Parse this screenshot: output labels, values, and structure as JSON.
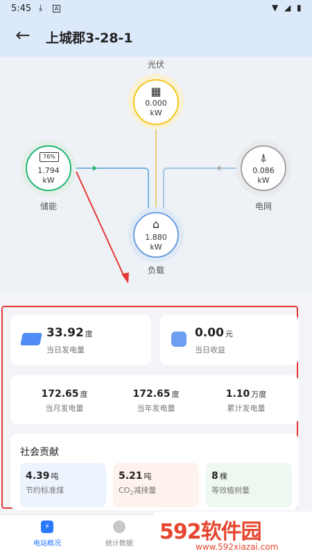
{
  "status": {
    "time": "5:45"
  },
  "header": {
    "title": "上城郡3-28-1"
  },
  "flow": {
    "pv": {
      "label": "光伏",
      "value": "0.000",
      "unit": "kW"
    },
    "storage": {
      "label": "储能",
      "value": "1.794",
      "unit": "kW",
      "battery": "76%"
    },
    "grid": {
      "label": "电网",
      "value": "0.086",
      "unit": "kW"
    },
    "load": {
      "label": "负载",
      "value": "1.880",
      "unit": "kW"
    }
  },
  "today": {
    "gen": {
      "value": "33.92",
      "unit": "度",
      "label": "当日发电量"
    },
    "income": {
      "value": "0.00",
      "unit": "元",
      "label": "当日收益"
    }
  },
  "totals": [
    {
      "value": "172.65",
      "unit": "度",
      "label": "当月发电量"
    },
    {
      "value": "172.65",
      "unit": "度",
      "label": "当年发电量"
    },
    {
      "value": "1.10",
      "unit": "万度",
      "label": "累计发电量"
    }
  ],
  "social": {
    "title": "社会贡献",
    "items": [
      {
        "value": "4.39",
        "unit": "吨",
        "label": "节约标准煤"
      },
      {
        "value": "5.21",
        "unit": "吨",
        "label_main": "CO",
        "label_sub": "2",
        "label_tail": "减排量"
      },
      {
        "value": "8",
        "unit": "棵",
        "label": "等效植树量"
      }
    ]
  },
  "tabs": [
    {
      "label": "电站概况"
    },
    {
      "label": "统计数据"
    }
  ],
  "watermark": {
    "brand": "592软件园",
    "url": "www.592xiazai.com"
  },
  "colors": {
    "accent": "#2979ff",
    "pv": "#f5c518",
    "storage": "#22b573",
    "grid": "#999999",
    "annot": "#e53935"
  }
}
